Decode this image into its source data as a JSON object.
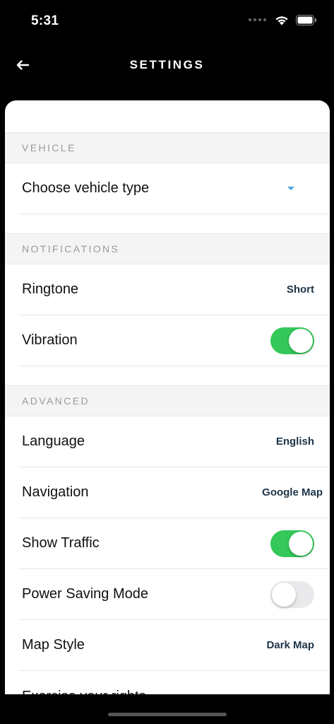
{
  "status_bar": {
    "time": "5:31"
  },
  "nav": {
    "title": "SETTINGS"
  },
  "sections": {
    "vehicle": {
      "header": "VEHICLE",
      "vehicle_type": {
        "label": "Choose vehicle type"
      }
    },
    "notifications": {
      "header": "NOTIFICATIONS",
      "ringtone": {
        "label": "Ringtone",
        "value": "Short"
      },
      "vibration": {
        "label": "Vibration",
        "enabled": true
      }
    },
    "advanced": {
      "header": "ADVANCED",
      "language": {
        "label": "Language",
        "value": "English"
      },
      "navigation": {
        "label": "Navigation",
        "value": "Google Map"
      },
      "show_traffic": {
        "label": "Show Traffic",
        "enabled": true
      },
      "power_saving": {
        "label": "Power Saving Mode",
        "enabled": false
      },
      "map_style": {
        "label": "Map Style",
        "value": "Dark Map"
      },
      "exercise_rights": {
        "label": "Exercise your rights"
      }
    }
  },
  "colors": {
    "toggle_on": "#34c759",
    "toggle_off": "#e9e9eb",
    "accent_caret": "#4aa3df",
    "value_text": "#1e3447"
  }
}
